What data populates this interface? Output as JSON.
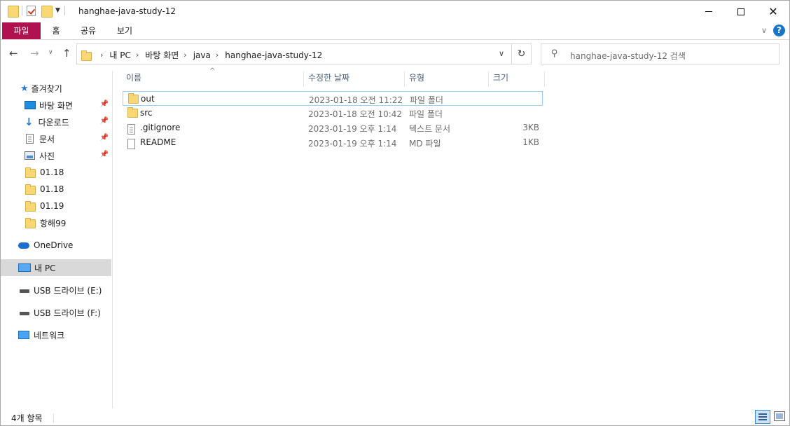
{
  "window": {
    "title": "hanghae-java-study-12"
  },
  "ribbon": {
    "tabs": [
      "파일",
      "홈",
      "공유",
      "보기"
    ]
  },
  "address": {
    "crumbs": [
      "내 PC",
      "바탕 화면",
      "java",
      "hanghae-java-study-12"
    ]
  },
  "search": {
    "placeholder": "hanghae-java-study-12 검색"
  },
  "nav": {
    "quick_access": "즐겨찾기",
    "items": [
      {
        "label": "바탕 화면",
        "icon": "desktop-icon",
        "pinned": true
      },
      {
        "label": "다운로드",
        "icon": "download-icon",
        "pinned": true
      },
      {
        "label": "문서",
        "icon": "document-icon",
        "pinned": true
      },
      {
        "label": "사진",
        "icon": "picture-icon",
        "pinned": true
      },
      {
        "label": "01.18",
        "icon": "folder-icon",
        "pinned": false
      },
      {
        "label": "01.18",
        "icon": "folder-icon",
        "pinned": false
      },
      {
        "label": "01.19",
        "icon": "folder-icon",
        "pinned": false
      },
      {
        "label": "항해99",
        "icon": "folder-icon",
        "pinned": false
      }
    ],
    "onedrive": "OneDrive",
    "this_pc": "내 PC",
    "usb_e": "USB 드라이브 (E:)",
    "usb_f": "USB 드라이브 (F:)",
    "network": "네트워크"
  },
  "columns": {
    "name": "이름",
    "date": "수정한 날짜",
    "type": "유형",
    "size": "크기"
  },
  "files": [
    {
      "name": "out",
      "date": "2023-01-18 오전 11:22",
      "type": "파일 폴더",
      "size": "",
      "icon": "folder-icon"
    },
    {
      "name": "src",
      "date": "2023-01-18 오전 10:42",
      "type": "파일 폴더",
      "size": "",
      "icon": "folder-icon"
    },
    {
      "name": ".gitignore",
      "date": "2023-01-19 오후 1:14",
      "type": "텍스트 문서",
      "size": "3KB",
      "icon": "text-file-icon"
    },
    {
      "name": "README",
      "date": "2023-01-19 오후 1:14",
      "type": "MD 파일",
      "size": "1KB",
      "icon": "file-icon"
    }
  ],
  "status": {
    "item_count": "4개 항목"
  },
  "colors": {
    "file_tab": "#b0124f",
    "selected_nav": "#d9d9d9",
    "focus_border": "#99d1ff",
    "accent": "#1874c8"
  }
}
